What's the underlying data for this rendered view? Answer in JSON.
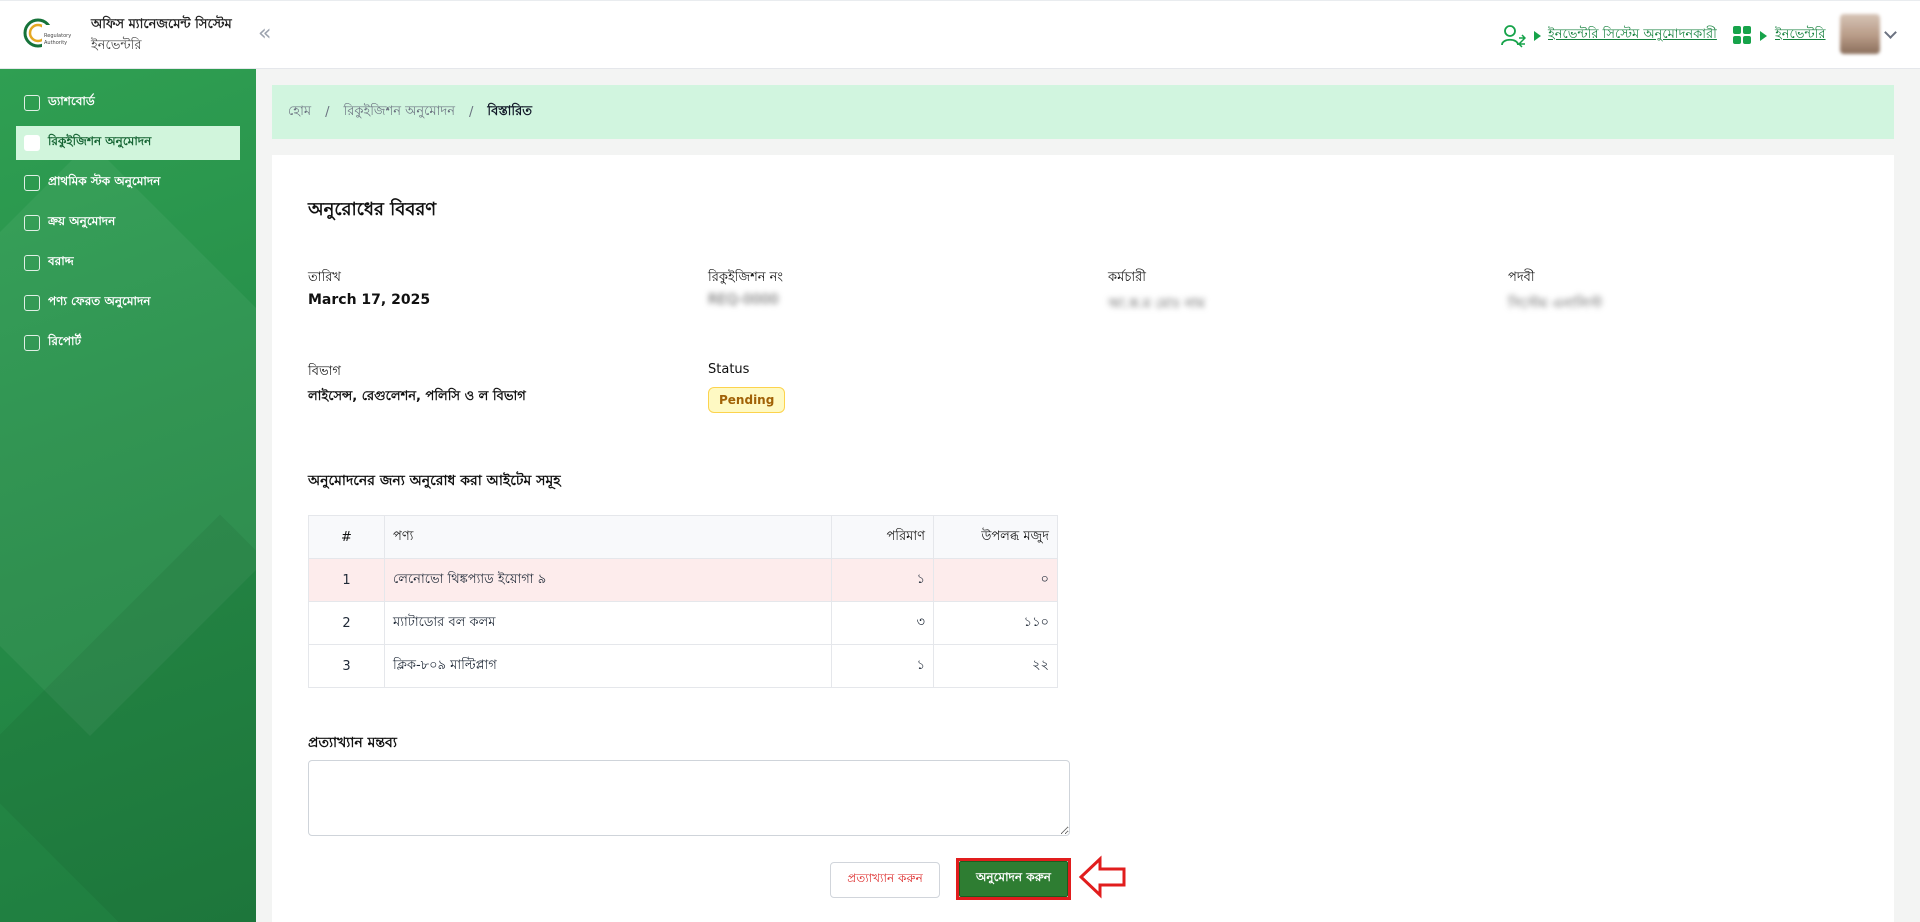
{
  "header": {
    "app_title": "অফিস ম্যানেজমেন্ট সিস্টেম",
    "app_subtitle": "ইনভেন্টরি",
    "collapse_symbol": "«",
    "role_link": "ইনভেন্টরি সিস্টেম অনুমোদনকারী",
    "module_link": "ইনভেন্টরি",
    "icons": [
      "logo",
      "user-switch-icon",
      "apps-grid-icon",
      "avatar",
      "chevron-down-icon"
    ]
  },
  "sidebar": {
    "items": [
      {
        "label": "ড্যাশবোর্ড",
        "icon": "dashboard-icon",
        "active": false
      },
      {
        "label": "রিকুইজিশন অনুমোদন",
        "icon": "requisition-icon",
        "active": true
      },
      {
        "label": "প্রাথমিক স্টক অনুমোদন",
        "icon": "stock-icon",
        "active": false
      },
      {
        "label": "ক্রয় অনুমোদন",
        "icon": "purchase-icon",
        "active": false
      },
      {
        "label": "বরাদ্দ",
        "icon": "allocation-icon",
        "active": false
      },
      {
        "label": "পণ্য ফেরত অনুমোদন",
        "icon": "return-icon",
        "active": false
      },
      {
        "label": "রিপোর্ট",
        "icon": "report-icon",
        "active": false
      }
    ]
  },
  "breadcrumb": {
    "home": "হোম",
    "parent": "রিকুইজিশন অনুমোদন",
    "current": "বিস্তারিত",
    "separator": "/"
  },
  "details": {
    "title": "অনুরোধের বিবরণ",
    "date_label": "তারিখ",
    "date_value": "March 17, 2025",
    "requisition_no_label": "রিকুইজিশন নং",
    "requisition_no_value": "REQ-0000",
    "employee_label": "কর্মচারী",
    "employee_value": "আ.ক.ম মোঃ নাম",
    "designation_label": "পদবী",
    "designation_value": "সিস্টেম এনালিস্ট",
    "department_label": "বিভাগ",
    "department_value": "লাইসেন্স, রেগুলেশন, পলিসি ও ল বিভাগ",
    "status_label": "Status",
    "status_value": "Pending"
  },
  "items_section": {
    "title": "অনুমোদনের জন্য অনুরোধ করা আইটেম সমূহ",
    "columns": [
      "#",
      "পণ্য",
      "পরিমাণ",
      "উপলব্ধ মজুদ"
    ],
    "rows": [
      {
        "num": "1",
        "product": "লেনোভো থিঙ্কপ্যাড ইয়োগা ৯",
        "qty": "১",
        "stock": "০",
        "warning": true
      },
      {
        "num": "2",
        "product": "ম্যাটাডোর বল কলম",
        "qty": "৩",
        "stock": "১১০",
        "warning": false
      },
      {
        "num": "3",
        "product": "ক্লিক-৮০৯ মাল্টিপ্লাগ",
        "qty": "১",
        "stock": "২২",
        "warning": false
      }
    ]
  },
  "remark": {
    "label": "প্রত্যাখ্যান মন্তব্য",
    "value": "",
    "placeholder": ""
  },
  "actions": {
    "reject_label": "প্রত্যাখ্যান করুন",
    "approve_label": "অনুমোদন করুন"
  },
  "colors": {
    "sidebar": "#27904a",
    "active_nav_bg": "#d1f5dc",
    "breadcrumb_bg": "#d1f5df",
    "approve": "#2e7d32",
    "reject_text": "#dc2626",
    "annotation": "#e11d1d",
    "pending_bg": "#fef9c3",
    "pending_text": "#a16207"
  }
}
